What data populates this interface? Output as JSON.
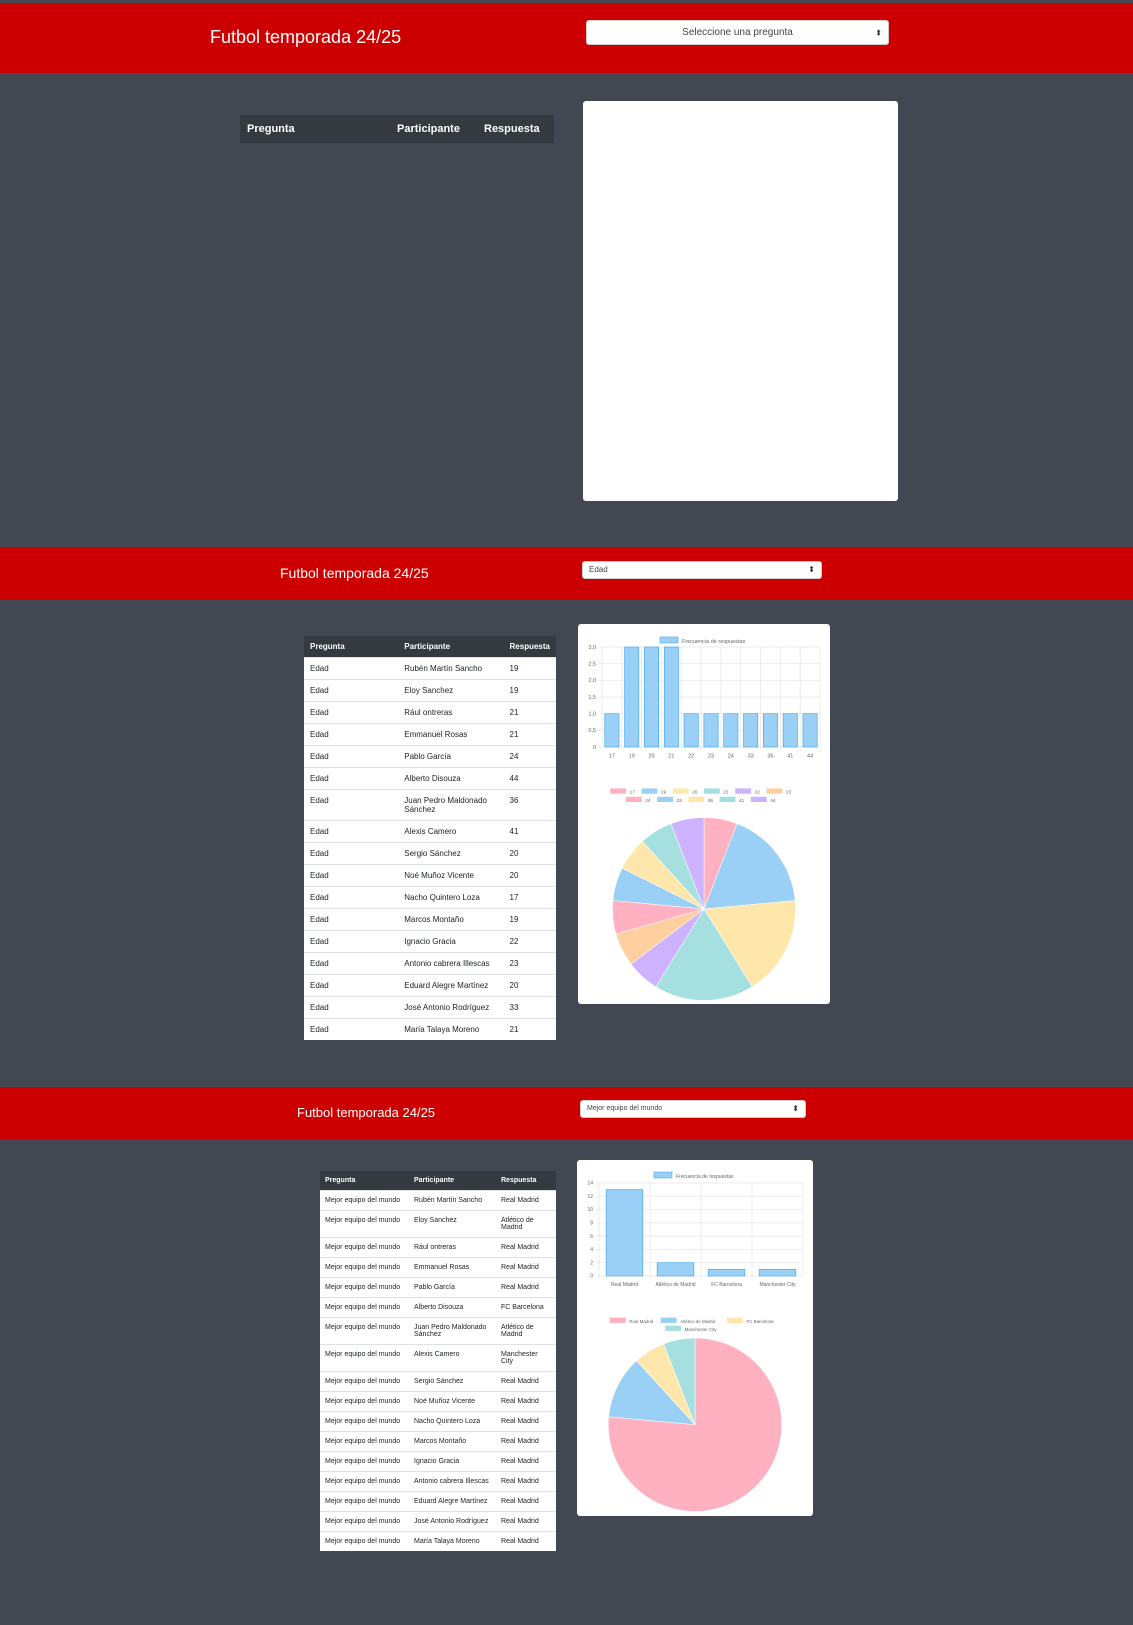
{
  "app": {
    "title": "Futbol temporada 24/25"
  },
  "table_headers": [
    "Pregunta",
    "Participante",
    "Respuesta"
  ],
  "colors": {
    "header_red": "#cc0000",
    "panel_bg": "#434751",
    "table_head": "#343a40"
  },
  "screens": [
    {
      "select_value": "Seleccione una pregunta",
      "rows": []
    },
    {
      "select_value": "Edad",
      "rows": [
        [
          "Edad",
          "Rubén Martín Sancho",
          "19"
        ],
        [
          "Edad",
          "Eloy Sanchez",
          "19"
        ],
        [
          "Edad",
          "Rául ontreras",
          "21"
        ],
        [
          "Edad",
          "Emmanuel Rosas",
          "21"
        ],
        [
          "Edad",
          "Pablo García",
          "24"
        ],
        [
          "Edad",
          "Alberto Disouza",
          "44"
        ],
        [
          "Edad",
          "Juan Pedro Maldonado Sánchez",
          "36"
        ],
        [
          "Edad",
          "Alexis Camero",
          "41"
        ],
        [
          "Edad",
          "Sergio Sánchez",
          "20"
        ],
        [
          "Edad",
          "Noé Muñoz Vicente",
          "20"
        ],
        [
          "Edad",
          "Nacho Quintero Loza",
          "17"
        ],
        [
          "Edad",
          "Marcos Montaño",
          "19"
        ],
        [
          "Edad",
          "Ignacio Gracia",
          "22"
        ],
        [
          "Edad",
          "Antonio cabrera Illescas",
          "23"
        ],
        [
          "Edad",
          "Eduard Alegre Martínez",
          "20"
        ],
        [
          "Edad",
          "José Antonio Rodríguez",
          "33"
        ],
        [
          "Edad",
          "María Talaya Moreno",
          "21"
        ]
      ]
    },
    {
      "select_value": "Mejor equipo del mundo",
      "rows": [
        [
          "Mejor equipo del mundo",
          "Rubén Martín Sancho",
          "Real Madrid"
        ],
        [
          "Mejor equipo del mundo",
          "Eloy Sanchez",
          "Atlético de Madrid"
        ],
        [
          "Mejor equipo del mundo",
          "Rául ontreras",
          "Real Madrid"
        ],
        [
          "Mejor equipo del mundo",
          "Emmanuel Rosas",
          "Real Madrid"
        ],
        [
          "Mejor equipo del mundo",
          "Pablo García",
          "Real Madrid"
        ],
        [
          "Mejor equipo del mundo",
          "Alberto Disouza",
          "FC Barcelona"
        ],
        [
          "Mejor equipo del mundo",
          "Juan Pedro Maldonado Sánchez",
          "Atlético de Madrid"
        ],
        [
          "Mejor equipo del mundo",
          "Alexis Camero",
          "Manchester City"
        ],
        [
          "Mejor equipo del mundo",
          "Sergio Sánchez",
          "Real Madrid"
        ],
        [
          "Mejor equipo del mundo",
          "Noé Muñoz Vicente",
          "Real Madrid"
        ],
        [
          "Mejor equipo del mundo",
          "Nacho Quintero Loza",
          "Real Madrid"
        ],
        [
          "Mejor equipo del mundo",
          "Marcos Montaño",
          "Real Madrid"
        ],
        [
          "Mejor equipo del mundo",
          "Ignacio Gracia",
          "Real Madrid"
        ],
        [
          "Mejor equipo del mundo",
          "Antonio cabrera Illescas",
          "Real Madrid"
        ],
        [
          "Mejor equipo del mundo",
          "Eduard Alegre Martínez",
          "Real Madrid"
        ],
        [
          "Mejor equipo del mundo",
          "José Antonio Rodríguez",
          "Real Madrid"
        ],
        [
          "Mejor equipo del mundo",
          "María Talaya Moreno",
          "Real Madrid"
        ]
      ]
    }
  ],
  "chart_data": [
    {
      "type": "bar",
      "title": "",
      "categories": [
        "17",
        "19",
        "20",
        "21",
        "22",
        "23",
        "24",
        "33",
        "36",
        "41",
        "44"
      ],
      "series": [
        {
          "name": "Frecuencia de respuestas",
          "values": [
            1,
            3,
            3,
            3,
            1,
            1,
            1,
            1,
            1,
            1,
            1
          ]
        }
      ],
      "y_ticks": [
        "0",
        "0,5",
        "1,0",
        "1,5",
        "2,0",
        "2,5",
        "3,0"
      ],
      "ylim": [
        0,
        3
      ],
      "grid": true,
      "legend": "top",
      "bar_color": "#9ad0f5"
    },
    {
      "type": "pie",
      "labels": [
        "17",
        "19",
        "20",
        "21",
        "22",
        "23",
        "24",
        "33",
        "36",
        "41",
        "44"
      ],
      "values": [
        1,
        3,
        3,
        3,
        1,
        1,
        1,
        1,
        1,
        1,
        1
      ],
      "colors": [
        "#ffb1c1",
        "#9ad0f5",
        "#ffe6aa",
        "#a5dfdf",
        "#ccb2ff",
        "#ffcf9f",
        "#ffb1c1",
        "#9ad0f5",
        "#ffe6aa",
        "#a5dfdf",
        "#ccb2ff"
      ],
      "legend": "top"
    },
    {
      "type": "bar",
      "title": "",
      "categories": [
        "Real Madrid",
        "Atlético de Madrid",
        "FC Barcelona",
        "Manchester City"
      ],
      "series": [
        {
          "name": "Frecuencia de respuestas",
          "values": [
            13,
            2,
            1,
            1
          ]
        }
      ],
      "y_ticks": [
        "0",
        "2",
        "4",
        "6",
        "8",
        "10",
        "12",
        "14"
      ],
      "ylim": [
        0,
        14
      ],
      "grid": true,
      "legend": "top",
      "bar_color": "#9ad0f5"
    },
    {
      "type": "pie",
      "labels": [
        "Real Madrid",
        "Atlético de Madrid",
        "FC Barcelona",
        "Manchester City"
      ],
      "values": [
        13,
        2,
        1,
        1
      ],
      "colors": [
        "#ffb1c1",
        "#9ad0f5",
        "#ffe6aa",
        "#a5dfdf"
      ],
      "legend": "top"
    }
  ]
}
